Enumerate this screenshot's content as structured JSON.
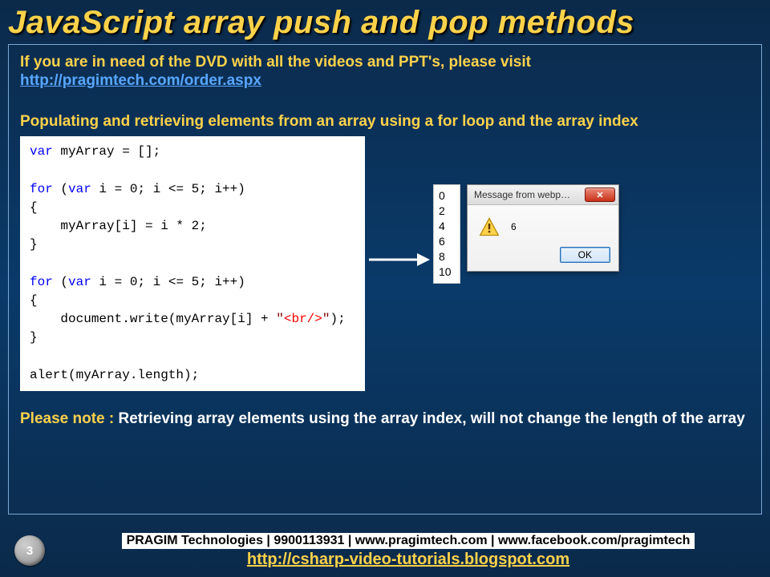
{
  "title": "JavaScript array push and pop methods",
  "intro": {
    "text": "If you are in need of the DVD with all the videos and PPT's, please visit",
    "link_label": "http://pragimtech.com/order.aspx"
  },
  "subhead": "Populating and retrieving elements from an array using a for loop and the array index",
  "code": {
    "line1_kw": "var",
    "line1_rest": " myArray = [];",
    "line2_kw": "for",
    "line2_rest1": " (",
    "line2_kw2": "var",
    "line2_rest2": " i = 0; i <= 5; i++)",
    "line3": "{",
    "line4": "    myArray[i] = i * 2;",
    "line5": "}",
    "line6_kw": "for",
    "line6_rest1": " (",
    "line6_kw2": "var",
    "line6_rest2": " i = 0; i <= 5; i++)",
    "line7": "{",
    "line8a": "    document.write(myArray[i] + ",
    "line8_q1": "\"",
    "line8_ent": "<br/>",
    "line8_q2": "\"",
    "line8b": ");",
    "line9": "}",
    "line10": "alert(myArray.length);"
  },
  "output_values": [
    "0",
    "2",
    "4",
    "6",
    "8",
    "10"
  ],
  "dialog": {
    "title": "Message from webp…",
    "message": "6",
    "ok_label": "OK"
  },
  "note": {
    "lead": "Please note : ",
    "rest": "Retrieving array elements using the array index, will not change the length of the array"
  },
  "footer": {
    "page_number": "3",
    "line1": "PRAGIM Technologies | 9900113931 | www.pragimtech.com | www.facebook.com/pragimtech",
    "link": "http://csharp-video-tutorials.blogspot.com"
  }
}
